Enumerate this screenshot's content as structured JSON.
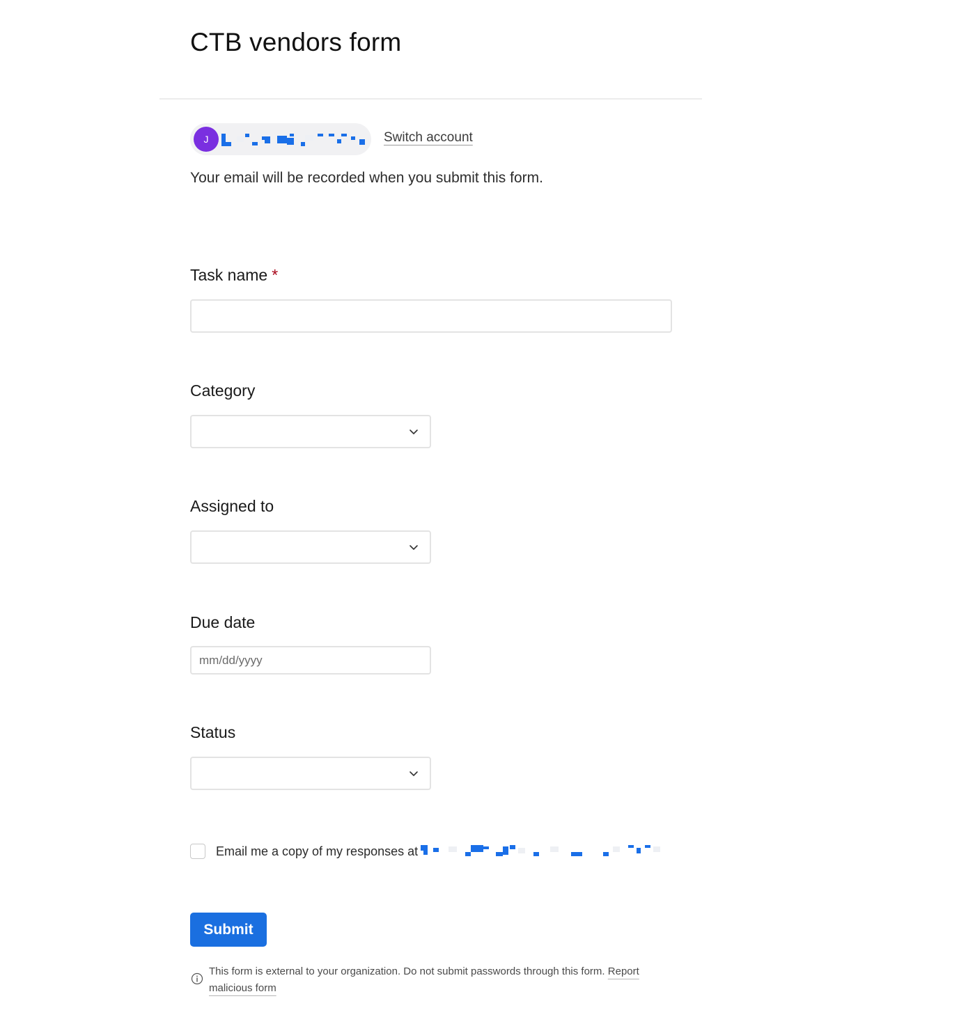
{
  "form": {
    "title": "CTB vendors form"
  },
  "account": {
    "avatar_initial": "J",
    "switch_label": "Switch account",
    "email_notice": "Your email will be recorded when you submit this form."
  },
  "fields": {
    "task_name": {
      "label": "Task name",
      "required_mark": "*",
      "value": ""
    },
    "category": {
      "label": "Category",
      "value": ""
    },
    "assigned_to": {
      "label": "Assigned to",
      "value": ""
    },
    "due_date": {
      "label": "Due date",
      "placeholder": "mm/dd/yyyy"
    },
    "status": {
      "label": "Status",
      "value": ""
    }
  },
  "email_copy": {
    "label": "Email me a copy of my responses at",
    "checked": false
  },
  "submit_label": "Submit",
  "footer": {
    "notice": "This form is external to your organization. Do not submit passwords through this form.",
    "report_label": "Report malicious form"
  },
  "colors": {
    "primary": "#1a6fe0",
    "avatar": "#7a2fe0",
    "required": "#a8071a"
  },
  "icons": {
    "dropdown": "chevron-down-icon",
    "info": "info-icon"
  }
}
